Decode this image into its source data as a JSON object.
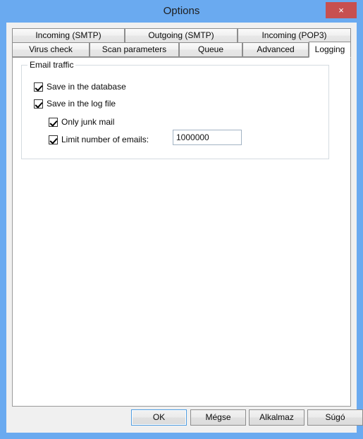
{
  "window": {
    "title": "Options",
    "close_label": "×",
    "close_icon": "close-icon",
    "titlebar_color": "#6aaaf0",
    "close_button_color": "#c75050"
  },
  "tabs": {
    "row1": [
      {
        "label": "Incoming (SMTP)",
        "selected": false
      },
      {
        "label": "Outgoing (SMTP)",
        "selected": false
      },
      {
        "label": "Incoming (POP3)",
        "selected": false
      }
    ],
    "row2": [
      {
        "label": "Virus check",
        "selected": false
      },
      {
        "label": "Scan parameters",
        "selected": false
      },
      {
        "label": "Queue",
        "selected": false
      },
      {
        "label": "Advanced",
        "selected": false
      },
      {
        "label": "Logging",
        "selected": true
      }
    ]
  },
  "page": {
    "groupbox": {
      "title": "Email traffic",
      "checkboxes": [
        {
          "label": "Save in the database",
          "checked": true
        },
        {
          "label": "Save in the log file",
          "checked": true
        },
        {
          "label": "Only junk mail",
          "checked": true
        },
        {
          "label": "Limit number of emails:",
          "checked": true
        }
      ],
      "limit_value": "1000000",
      "limit_placeholder": ""
    }
  },
  "footer": {
    "buttons": [
      {
        "label": "OK",
        "default": true
      },
      {
        "label": "Mégse",
        "default": false
      },
      {
        "label": "Alkalmaz",
        "default": false
      },
      {
        "label": "Súgó",
        "default": false
      }
    ]
  }
}
